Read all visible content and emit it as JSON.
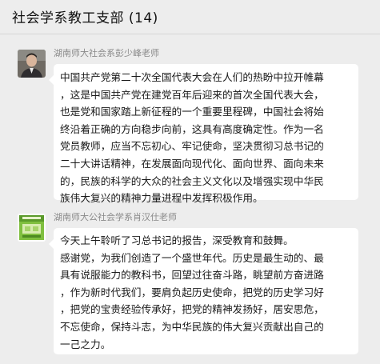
{
  "chat": {
    "title": "社会学系教工支部 (14)"
  },
  "messages": [
    {
      "sender": "湖南师大社会系彭少峰老师",
      "avatar_icon": "person-avatar",
      "lines": [
        "中国共产党第二十次全国代表大会在人们的热盼中拉开帷幕",
        "，这是中国共产党在建党百年后迎来的首次全国代表大会，",
        "也是党和国家踏上新征程的一个重要里程碑，中国社会将始",
        "终沿着正确的方向稳步向前，这具有高度确定性。作为一名",
        "党员教师，应当不忘初心、牢记使命，坚决贯彻习总书记的",
        "二十大讲话精神，在发展面向现代化、面向世界、面向未来",
        "的，民族的科学的大众的社会主义文化以及增强实现中华民",
        "族伟大复兴的精神力量进程中发挥积极作用。"
      ]
    },
    {
      "sender": "湖南师大公社会学系肖汉仕老师",
      "avatar_icon": "book-cover-avatar",
      "lines": [
        "今天上午聆听了习总书记的报告，深受教育和鼓舞。",
        "感谢党，为我们创造了一个盛世年代。历史是最生动的、最",
        "具有说服能力的教科书，回望过往奋斗路，眺望前方奋进路",
        "，作为新时代我们，要肩负起历史使命，把党的历史学习好",
        "，把党的宝贵经验传承好，把党的精神发扬好，居安思危，",
        "不忘使命，保持斗志，为中华民族的伟大复兴贡献出自己的",
        "一己之力。"
      ]
    }
  ]
}
